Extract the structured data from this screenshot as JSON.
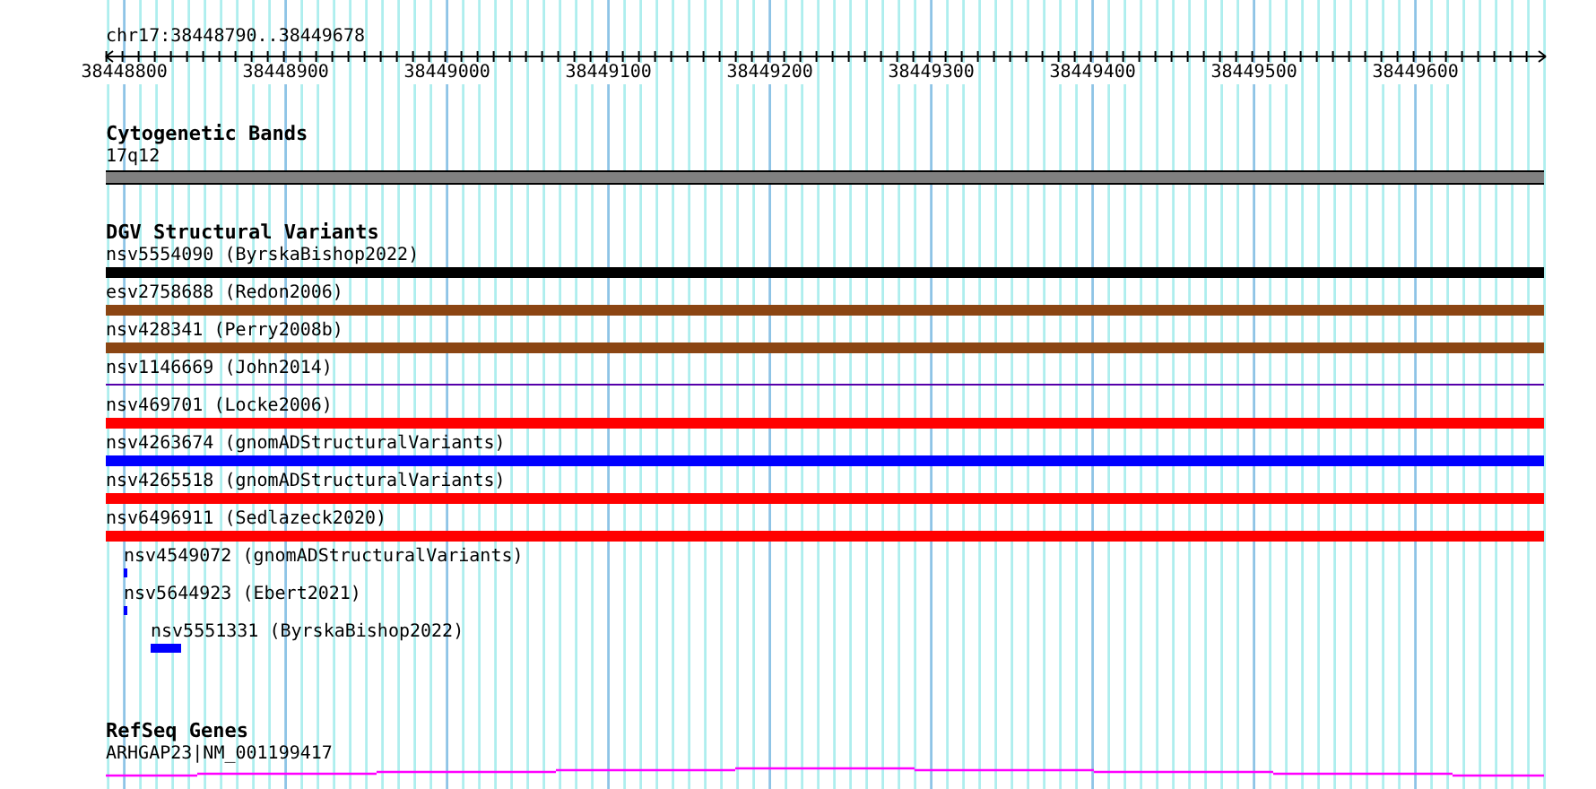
{
  "ruler": {
    "region": "chr17:38448790..38449678",
    "ticks": [
      "38448800",
      "38448900",
      "38449000",
      "38449100",
      "38449200",
      "38449300",
      "38449400",
      "38449500",
      "38449600"
    ]
  },
  "cytogenetic_bands": {
    "title": "Cytogenetic Bands",
    "band": {
      "label": "17q12"
    }
  },
  "dgv": {
    "title": "DGV Structural Variants",
    "variants": [
      {
        "label": "nsv5554090 (ByrskaBishop2022)",
        "kind": "bar",
        "color": "#000000"
      },
      {
        "label": "esv2758688 (Redon2006)",
        "kind": "bar",
        "color": "#8b4513"
      },
      {
        "label": "nsv428341 (Perry2008b)",
        "kind": "bar",
        "color": "#8b4513"
      },
      {
        "label": "nsv1146669 (John2014)",
        "kind": "line",
        "color": "#5500aa"
      },
      {
        "label": "nsv469701 (Locke2006)",
        "kind": "bar",
        "color": "#ff0000"
      },
      {
        "label": "nsv4263674 (gnomADStructuralVariants)",
        "kind": "bar",
        "color": "#0000ff"
      },
      {
        "label": "nsv4265518 (gnomADStructuralVariants)",
        "kind": "bar",
        "color": "#ff0000"
      },
      {
        "label": "nsv6496911 (Sedlazeck2020)",
        "kind": "bar",
        "color": "#ff0000"
      },
      {
        "label": "nsv4549072 (gnomADStructuralVariants)",
        "kind": "small",
        "color": "#0000ff"
      },
      {
        "label": "nsv5644923 (Ebert2021)",
        "kind": "small",
        "color": "#0000ff"
      },
      {
        "label": "nsv5551331 (ByrskaBishop2022)",
        "kind": "small",
        "color": "#0000ff"
      }
    ]
  },
  "refseq": {
    "title": "RefSeq Genes",
    "gene": {
      "label": "ARHGAP23|NM_001199417"
    }
  }
}
